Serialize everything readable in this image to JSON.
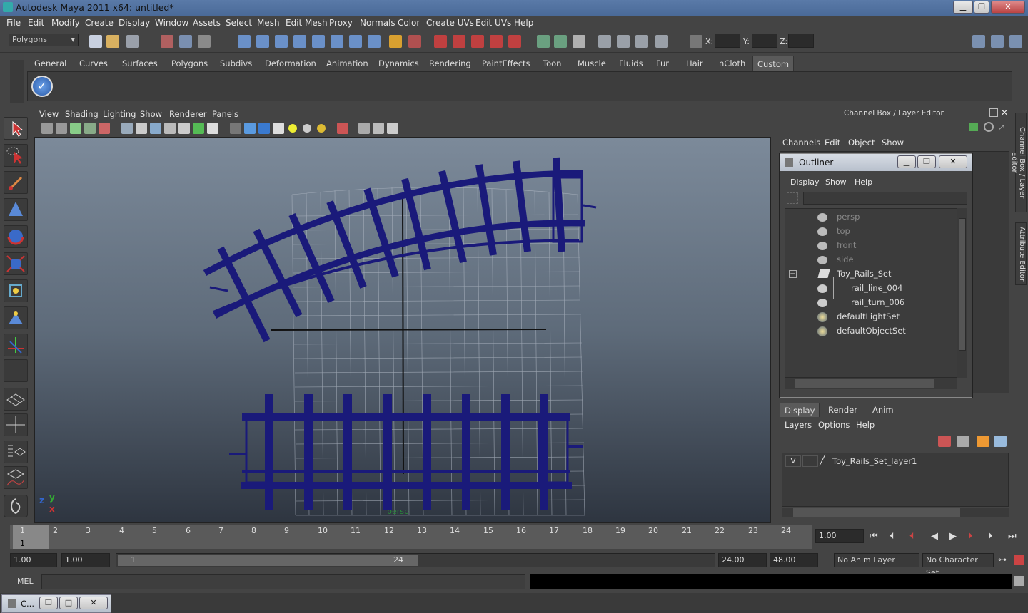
{
  "window": {
    "title": "Autodesk Maya 2011 x64: untitled*",
    "min_label": "▁",
    "max_label": "❐",
    "close_label": "✕"
  },
  "menubar": [
    "File",
    "Edit",
    "Modify",
    "Create",
    "Display",
    "Window",
    "Assets",
    "Select",
    "Mesh",
    "Edit Mesh",
    "Proxy",
    "Normals",
    "Color",
    "Create UVs",
    "Edit UVs",
    "Help"
  ],
  "status_line": {
    "mode": "Polygons",
    "x_label": "X:",
    "y_label": "Y:",
    "z_label": "Z:"
  },
  "shelf_tabs": [
    "General",
    "Curves",
    "Surfaces",
    "Polygons",
    "Subdivs",
    "Deformation",
    "Animation",
    "Dynamics",
    "Rendering",
    "PaintEffects",
    "Toon",
    "Muscle",
    "Fluids",
    "Fur",
    "Hair",
    "nCloth",
    "Custom"
  ],
  "shelf_active_tab": "Custom",
  "panel_menu": [
    "View",
    "Shading",
    "Lighting",
    "Show",
    "Renderer",
    "Panels"
  ],
  "viewport": {
    "camera_label": "persp",
    "axis_y": "y",
    "axis_x": "x",
    "axis_z": "z"
  },
  "channel_box": {
    "title": "Channel Box / Layer Editor",
    "menus": [
      "Channels",
      "Edit",
      "Object",
      "Show"
    ]
  },
  "side_tabs": [
    "Channel Box / Layer Editor",
    "Attribute Editor"
  ],
  "outliner": {
    "title": "Outliner",
    "menus": [
      "Display",
      "Show",
      "Help"
    ],
    "items": [
      {
        "label": "persp",
        "dim": true,
        "indent": 0
      },
      {
        "label": "top",
        "dim": true,
        "indent": 0
      },
      {
        "label": "front",
        "dim": true,
        "indent": 0
      },
      {
        "label": "side",
        "dim": true,
        "indent": 0
      },
      {
        "label": "Toy_Rails_Set",
        "dim": false,
        "indent": 0
      },
      {
        "label": "rail_line_004",
        "dim": false,
        "indent": 1
      },
      {
        "label": "rail_turn_006",
        "dim": false,
        "indent": 1
      },
      {
        "label": "defaultLightSet",
        "dim": false,
        "indent": 0
      },
      {
        "label": "defaultObjectSet",
        "dim": false,
        "indent": 0
      }
    ]
  },
  "layer_editor": {
    "tabs": [
      "Display",
      "Render",
      "Anim"
    ],
    "menus": [
      "Layers",
      "Options",
      "Help"
    ],
    "layer_visible": "V",
    "layer_name": "Toy_Rails_Set_layer1"
  },
  "timeline": {
    "ticks": [
      "1",
      "2",
      "3",
      "4",
      "5",
      "6",
      "7",
      "8",
      "9",
      "10",
      "11",
      "12",
      "13",
      "14",
      "15",
      "16",
      "17",
      "18",
      "19",
      "20",
      "21",
      "22",
      "23",
      "24"
    ],
    "current_frame_marker": "1",
    "current_time": "1.00"
  },
  "range": {
    "start": "1.00",
    "playback_start": "1.00",
    "slider_start": "1",
    "slider_end": "24",
    "playback_end": "24.00",
    "end": "48.00",
    "anim_layer": "No Anim Layer",
    "character_set": "No Character Set"
  },
  "command_line": {
    "label": "MEL"
  },
  "taskbar": {
    "item_label": "C..."
  }
}
